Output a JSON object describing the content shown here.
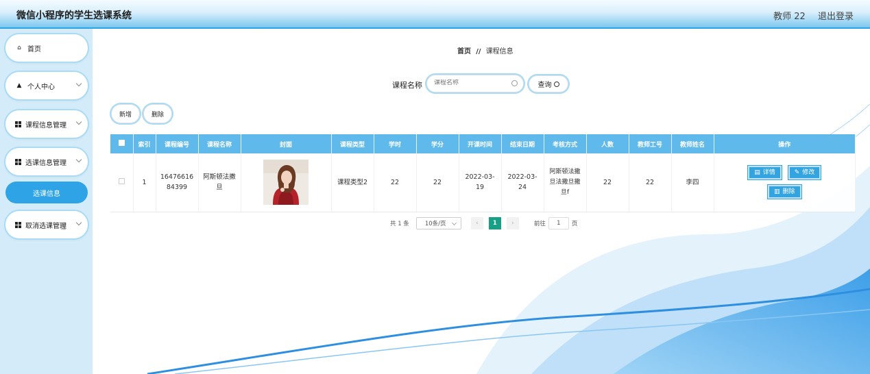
{
  "header": {
    "title": "微信小程序的学生选课系统",
    "user_label": "教师 22",
    "logout_label": "退出登录"
  },
  "sidebar": {
    "items": [
      {
        "label": "首页",
        "icon": "home-icon"
      },
      {
        "label": "个人中心",
        "icon": "user-icon"
      },
      {
        "label": "课程信息管理",
        "icon": "grid-icon"
      },
      {
        "label": "选课信息管理",
        "icon": "grid-icon"
      },
      {
        "label": "取消选课管理",
        "icon": "grid-icon"
      }
    ],
    "active_sub": "选课信息"
  },
  "breadcrumb": {
    "home": "首页",
    "separator": "//",
    "current": "课程信息"
  },
  "search": {
    "label": "课程名称",
    "placeholder": "课程名称",
    "button": "查询"
  },
  "toolbar": {
    "add": "新增",
    "delete": "删除"
  },
  "table": {
    "headers": [
      "索引",
      "课程编号",
      "课程名称",
      "封面",
      "课程类型",
      "学时",
      "学分",
      "开课时间",
      "结束日期",
      "考核方式",
      "人数",
      "教师工号",
      "教师姓名",
      "操作"
    ],
    "rows": [
      {
        "index": "1",
        "course_no": "1647661684399",
        "course_name": "阿斯顿法撒旦",
        "course_type": "课程类型2",
        "hours": "22",
        "credits": "22",
        "start": "2022-03-19",
        "end": "2022-03-24",
        "assessment": "阿斯顿法撒旦法撒旦撒旦f",
        "people": "22",
        "teacher_id": "22",
        "teacher_name": "李四"
      }
    ],
    "actions": {
      "detail": "详情",
      "edit": "修改",
      "delete": "删除"
    }
  },
  "pagination": {
    "total": "共 1 条",
    "page_size": "10条/页",
    "current_page": "1",
    "goto_label": "前往",
    "goto_value": "1",
    "page_suffix": "页"
  },
  "colors": {
    "accent": "#2ea3e6",
    "header": "#5fb9ea",
    "current_page": "#16a085"
  }
}
